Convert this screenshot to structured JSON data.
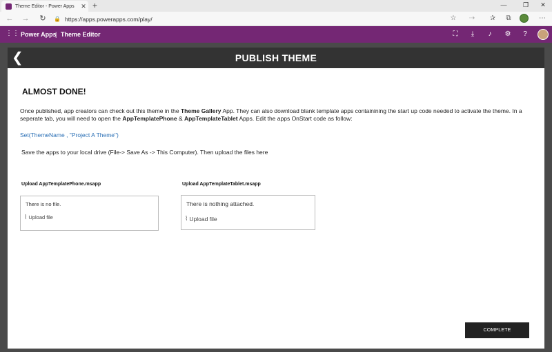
{
  "browser": {
    "tab_title": "Theme Editor - Power Apps",
    "tab_close": "✕",
    "new_tab": "+",
    "minimize": "—",
    "maximize": "❐",
    "close": "✕",
    "url": "https://apps.powerapps.com/play/"
  },
  "app_header": {
    "app_name": "Power Apps",
    "separator": "|",
    "section": "Theme Editor"
  },
  "page": {
    "title": "PUBLISH THEME",
    "back_glyph": "❮",
    "heading": "ALMOST DONE!",
    "para_1": "Once published, app creators can check out this theme in the ",
    "para_bold_1": "Theme Gallery",
    "para_2": " App. They can also download blank template apps containining the start up code needed to activate the theme. In a seperate tab, you will need to open the ",
    "para_bold_2": "AppTemplatePhone",
    "para_3": " & ",
    "para_bold_3": "AppTemplateTablet",
    "para_4": " Apps. Edit the apps OnStart code as follow:",
    "code": "Set(ThemeName , \"Project A Theme\")",
    "save_instructions": "Save the apps to your local drive (File-> Save As -> This Computer).  Then upload the files here"
  },
  "uploads": {
    "phone": {
      "label": "Upload AppTemplatePhone.msapp",
      "status": "There is no file.",
      "button": "Upload file"
    },
    "tablet": {
      "label": "Upload AppTemplateTablet.msapp",
      "status": "There is nothing attached.",
      "button": "Upload file"
    }
  },
  "actions": {
    "complete": "COMPLETE"
  },
  "colors": {
    "brand": "#742774",
    "title_bar": "#333333",
    "link": "#2a6fb5"
  }
}
